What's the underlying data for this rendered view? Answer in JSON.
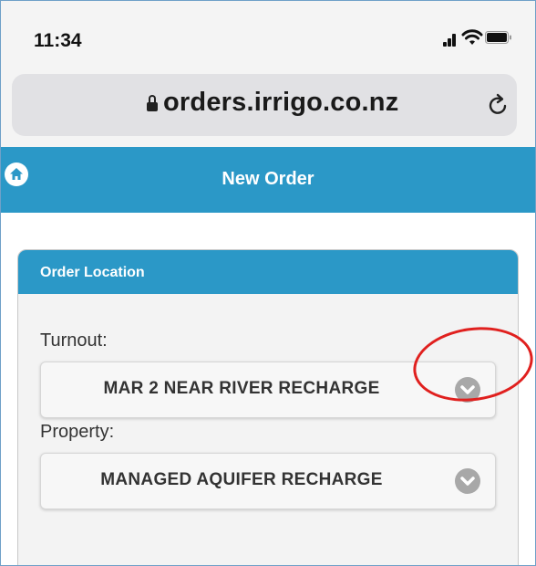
{
  "status_bar": {
    "time": "11:34"
  },
  "browser": {
    "url": "orders.irrigo.co.nz"
  },
  "app_header": {
    "title": "New Order"
  },
  "order_location": {
    "heading": "Order Location",
    "turnout": {
      "label": "Turnout:",
      "value": "MAR 2 NEAR RIVER RECHARGE"
    },
    "property": {
      "label": "Property:",
      "value": "MANAGED AQUIFER RECHARGE"
    }
  },
  "colors": {
    "header_blue": "#2b98c7",
    "annotation_red": "#e0201e"
  },
  "icons": {
    "home": "home-icon",
    "lock": "lock-icon",
    "reload": "reload-icon",
    "dropdown": "chevron-down-icon",
    "signal": "cellular-signal-icon",
    "wifi": "wifi-icon",
    "battery": "battery-icon"
  }
}
